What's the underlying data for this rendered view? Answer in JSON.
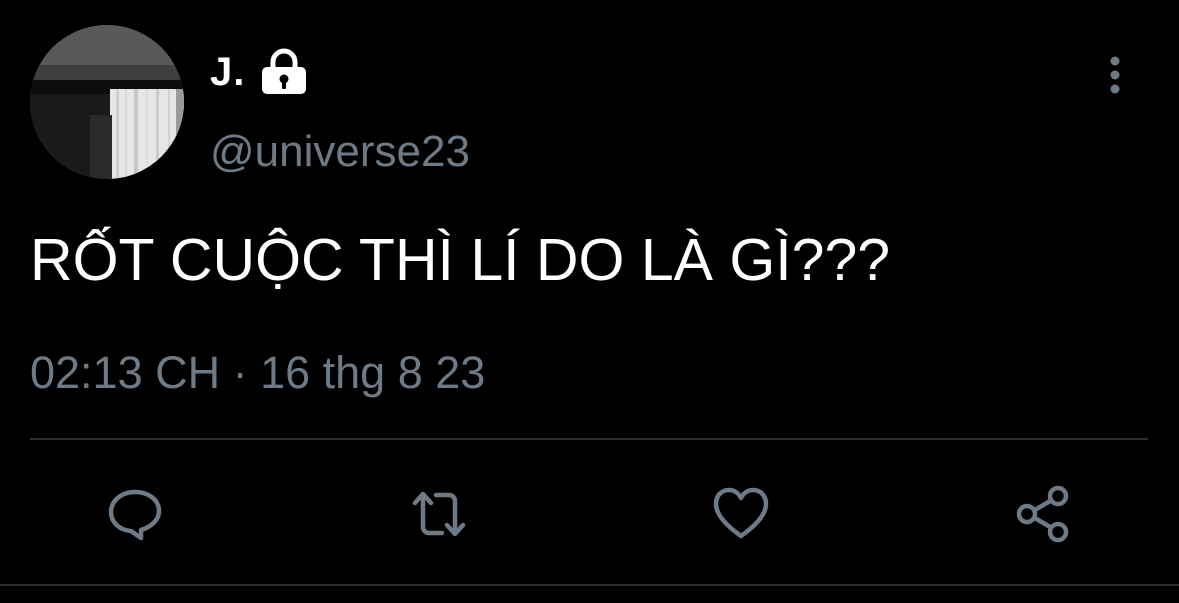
{
  "tweet": {
    "author": {
      "display_name": "J.",
      "handle": "@universe23",
      "protected_icon": "lock-icon"
    },
    "text": "RỐT CUỘC THÌ LÍ DO LÀ GÌ???",
    "timestamp": "02:13 CH · 16 thg 8 23"
  },
  "actions": {
    "reply_icon": "reply-icon",
    "retweet_icon": "retweet-icon",
    "like_icon": "heart-icon",
    "share_icon": "share-icon",
    "more_icon": "more-vertical-icon"
  },
  "colors": {
    "background": "#000000",
    "primary_text": "#ffffff",
    "secondary_text": "#6e7b87",
    "icon": "#6e7b87",
    "divider": "#2a2f34"
  }
}
